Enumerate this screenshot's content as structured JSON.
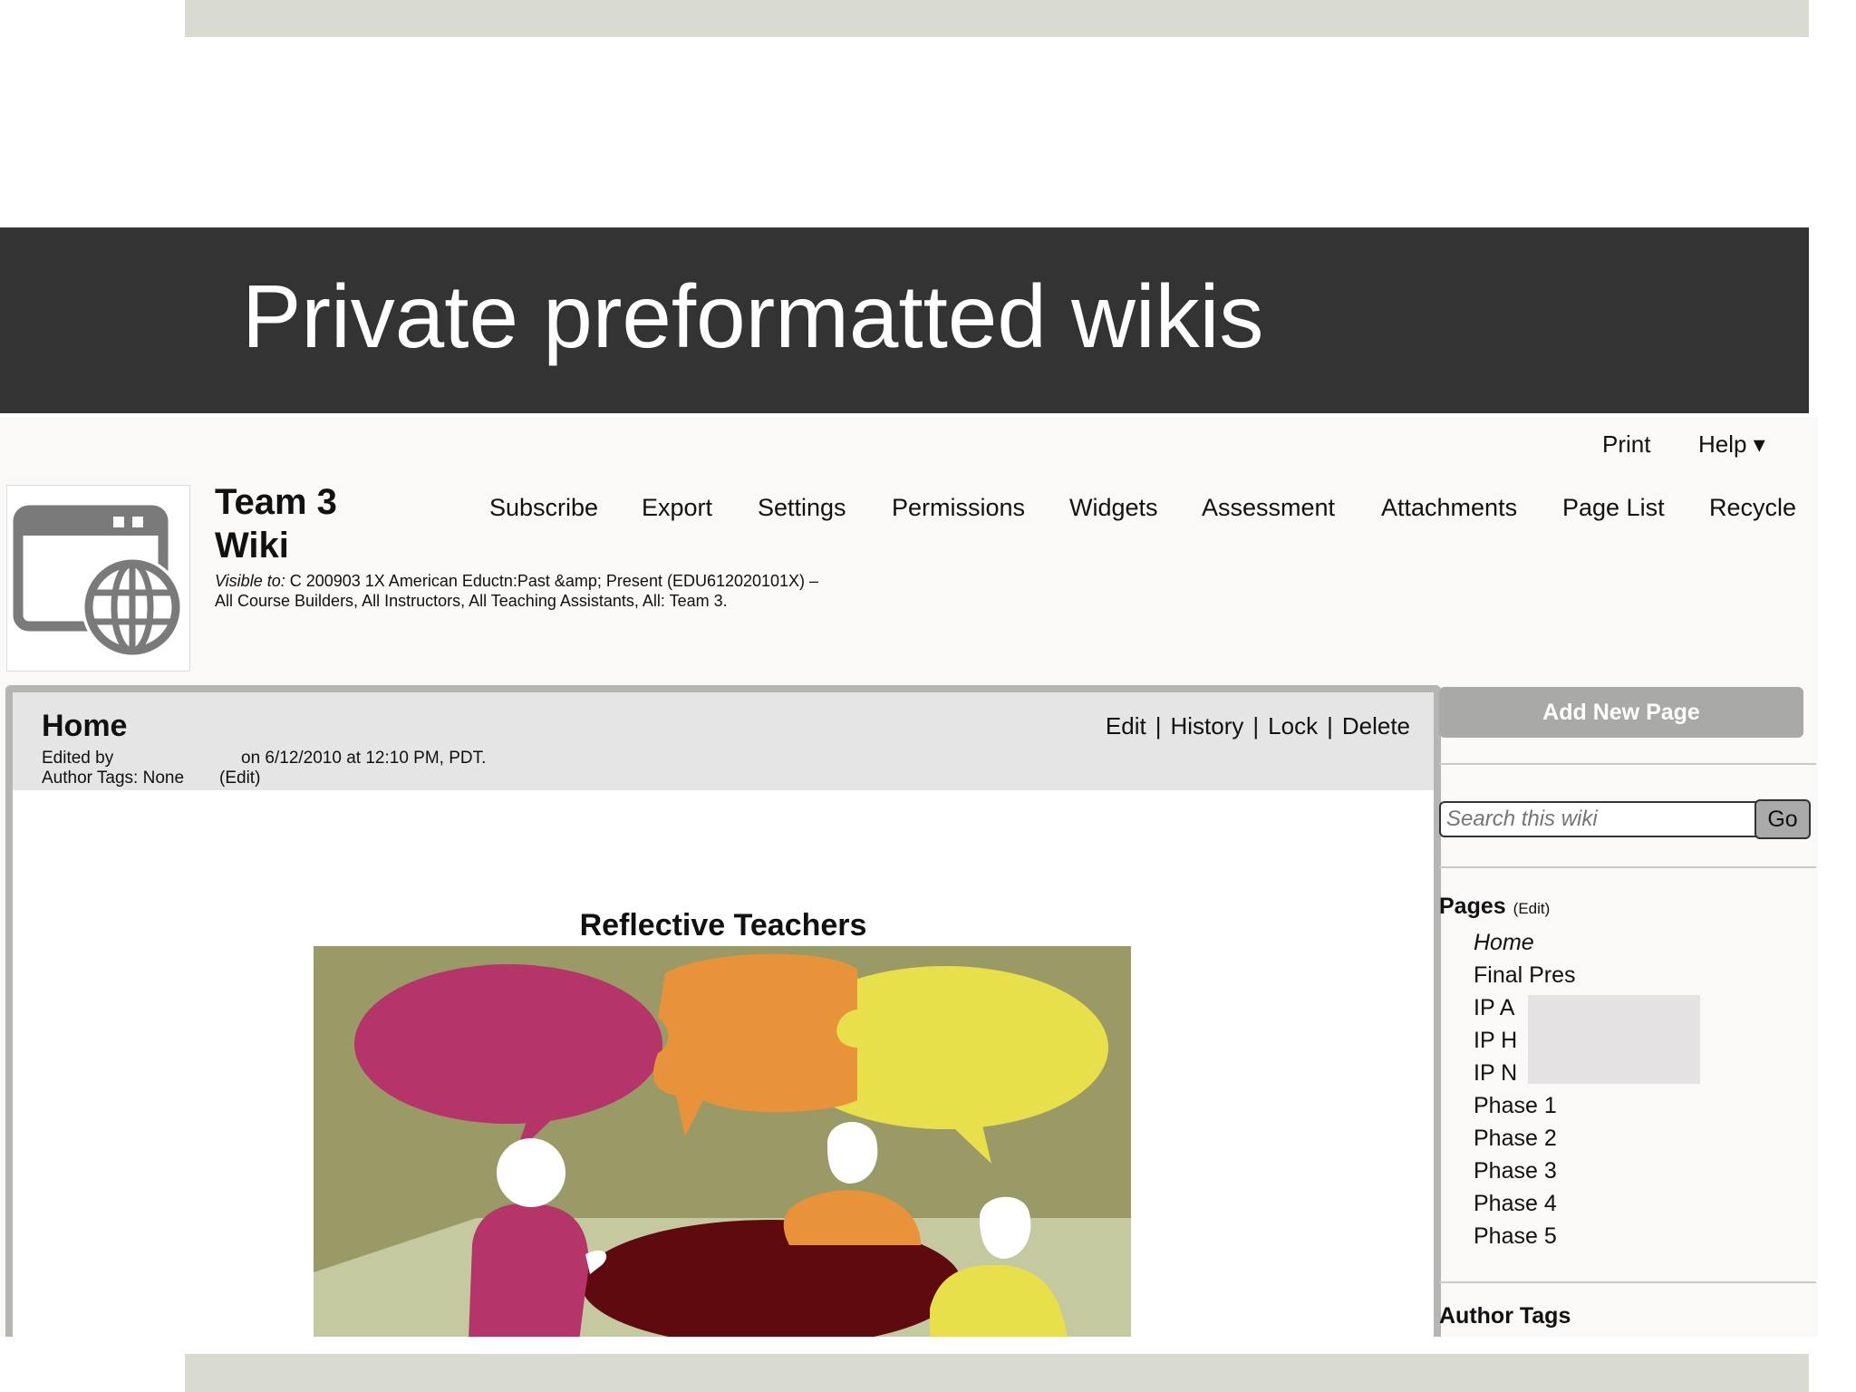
{
  "slide": {
    "title": "Private preformatted wikis"
  },
  "utility": {
    "print": "Print",
    "help": "Help ▾"
  },
  "wiki": {
    "name_line1": "Team 3",
    "name_line2": "Wiki",
    "visible_label": "Visible to:",
    "visible_line1": " C 200903 1X American Eductn:Past &amp; Present (EDU612020101X) –",
    "visible_line2": "All Course Builders, All Instructors, All Teaching Assistants, All: Team 3.",
    "logo_icon": "wiki-globe-icon"
  },
  "nav": {
    "subscribe": "Subscribe",
    "export": "Export",
    "settings": "Settings",
    "permissions": "Permissions",
    "widgets": "Widgets",
    "assessment": "Assessment",
    "attachments": "Attachments",
    "page_list": "Page List",
    "recycle": "Recycle"
  },
  "page": {
    "title": "Home",
    "edited_by": "Edited by",
    "edited_on": "on 6/12/2010 at 12:10 PM, PDT.",
    "author_tags": "Author Tags: None",
    "author_tags_edit": "(Edit)",
    "actions": {
      "edit": "Edit",
      "history": "History",
      "lock": "Lock",
      "delete": "Delete",
      "separator": "|"
    },
    "article_title": "Reflective Teachers"
  },
  "sidebar": {
    "add_new_page": "Add New Page",
    "search_placeholder": "Search this wiki",
    "go": "Go",
    "pages_heading": "Pages",
    "pages_edit": "(Edit)",
    "pages": [
      "Home",
      "Final Pres",
      "IP A",
      "IP H",
      "IP N",
      "Phase 1",
      "Phase 2",
      "Phase 3",
      "Phase 4",
      "Phase 5"
    ],
    "author_tags_heading": "Author Tags"
  },
  "colors": {
    "title_bar": "#333333",
    "band": "#d9dbd0",
    "illustration_bg": "#9a9a66",
    "bubble_magenta": "#b5346a",
    "bubble_orange": "#e8933a",
    "bubble_yellow": "#e8e04a",
    "table": "#5e0a0e"
  }
}
